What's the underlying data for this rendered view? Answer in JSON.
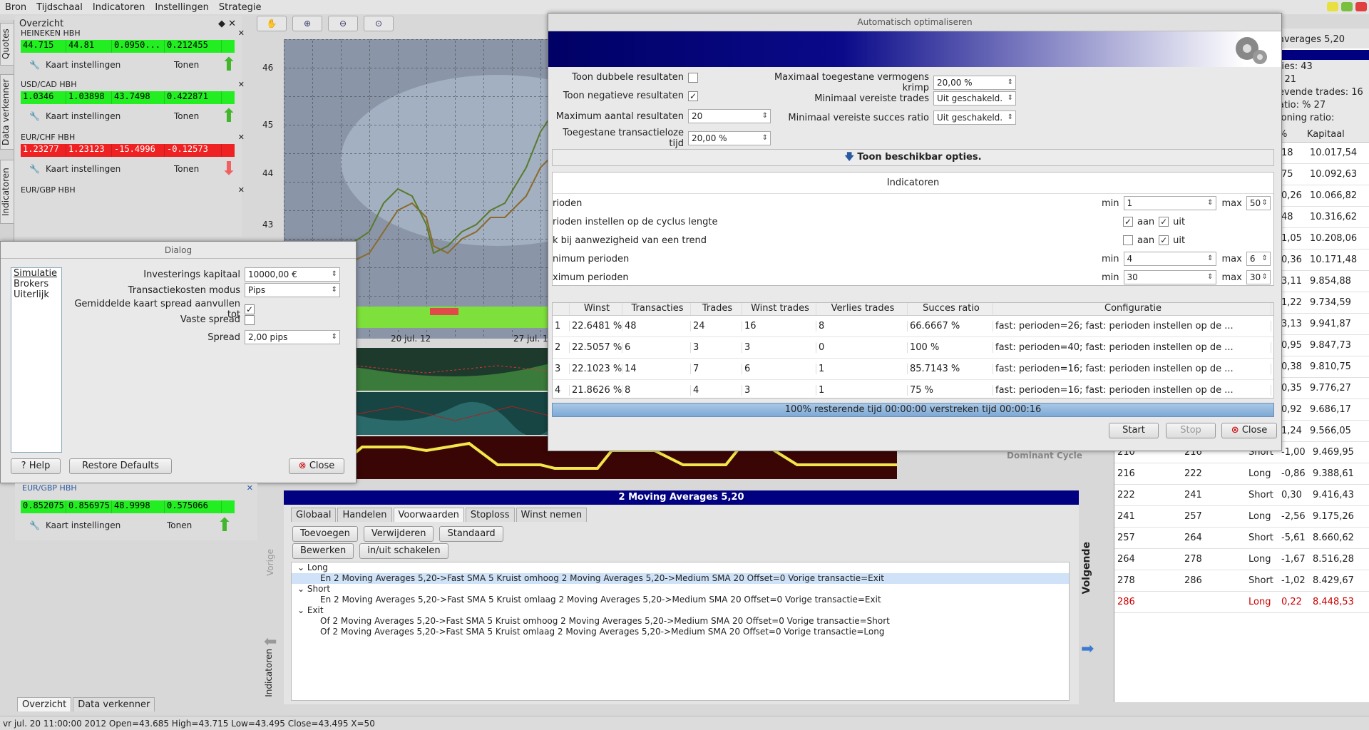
{
  "menubar": {
    "items": [
      "Bron",
      "Tijdschaal",
      "Indicatoren",
      "Instellingen",
      "Strategie"
    ]
  },
  "vtabs": [
    "Quotes",
    "Data verkenner",
    "Indicatoren"
  ],
  "overview": {
    "title": "Overzicht",
    "quotes": [
      {
        "name": "HEINEKEN HBH",
        "values": [
          "44.715",
          "44.81",
          "0.0950...",
          "0.212455"
        ],
        "color": "#22ee22",
        "settings": "Kaart instellingen",
        "show": "Tonen",
        "direction": "up"
      },
      {
        "name": "USD/CAD HBH",
        "values": [
          "1.0346",
          "1.03898",
          "43.7498",
          "0.422871"
        ],
        "color": "#22ee22",
        "settings": "Kaart instellingen",
        "show": "Tonen",
        "direction": "up"
      },
      {
        "name": "EUR/CHF HBH",
        "values": [
          "1.23277",
          "1.23123",
          "-15.4996",
          "-0.12573"
        ],
        "color": "#ee2222",
        "settings": "Kaart instellingen",
        "show": "Tonen",
        "direction": "down"
      },
      {
        "name": "EUR/GBP HBH",
        "values": [],
        "color": "",
        "settings": "",
        "show": "",
        "direction": ""
      }
    ],
    "bottom_quote": {
      "name": "EUR/GBP HBH",
      "values": [
        "0.852075",
        "0.856975",
        "48.9998",
        "0.575066"
      ],
      "settings": "Kaart instellingen",
      "show": "Tonen"
    },
    "bottom_tabs": [
      "Overzicht",
      "Data verkenner"
    ]
  },
  "chart": {
    "yticks": [
      "46",
      "45",
      "44",
      "43"
    ],
    "xticks": [
      "20 jul. 12",
      "27 jul. 1"
    ],
    "indicator_label": "Dominant Cycle"
  },
  "right_table": {
    "title": "averages 5,20",
    "stats": [
      ":ies: 43",
      ": 21",
      "evende trades: 16",
      "atio: % 27",
      "loning ratio:"
    ],
    "header": [
      "%",
      "Kapitaal"
    ],
    "rows_top": [
      {
        "pct": "18",
        "cap": "10.017,54"
      },
      {
        "pct": "75",
        "cap": "10.092,63"
      },
      {
        "pct": "0,26",
        "cap": "10.066,82"
      },
      {
        "pct": "48",
        "cap": "10.316,62"
      },
      {
        "pct": "1,05",
        "cap": "10.208,06"
      },
      {
        "pct": "0,36",
        "cap": "10.171,48"
      },
      {
        "pct": "3,11",
        "cap": "9.854,88"
      },
      {
        "pct": "1,22",
        "cap": "9.734,59"
      },
      {
        "pct": "3,13",
        "cap": "9.941,87"
      },
      {
        "pct": "0,95",
        "cap": "9.847,73"
      },
      {
        "pct": "0,38",
        "cap": "9.810,75"
      },
      {
        "pct": "0,35",
        "cap": "9.776,27"
      },
      {
        "pct": "0,92",
        "cap": "9.686,17"
      },
      {
        "pct": "1,24",
        "cap": "9.566,05"
      }
    ],
    "rows": [
      {
        "a": "210",
        "b": "216",
        "type": "Short",
        "pct": "-1,00",
        "cap": "9.469,95"
      },
      {
        "a": "216",
        "b": "222",
        "type": "Long",
        "pct": "-0,86",
        "cap": "9.388,61"
      },
      {
        "a": "222",
        "b": "241",
        "type": "Short",
        "pct": "0,30",
        "cap": "9.416,43"
      },
      {
        "a": "241",
        "b": "257",
        "type": "Long",
        "pct": "-2,56",
        "cap": "9.175,26"
      },
      {
        "a": "257",
        "b": "264",
        "type": "Short",
        "pct": "-5,61",
        "cap": "8.660,62"
      },
      {
        "a": "264",
        "b": "278",
        "type": "Long",
        "pct": "-1,67",
        "cap": "8.516,28"
      },
      {
        "a": "278",
        "b": "286",
        "type": "Short",
        "pct": "-1,02",
        "cap": "8.429,67"
      },
      {
        "a": "286",
        "b": "",
        "type": "Long",
        "pct": "0,22",
        "cap": "8.448,53"
      }
    ]
  },
  "optimizer": {
    "title": "Automatisch optimaliseren",
    "left_fields": [
      {
        "label": "Toon dubbele resultaten",
        "type": "check",
        "value": ""
      },
      {
        "label": "Toon negatieve resultaten",
        "type": "check",
        "value": "✓"
      },
      {
        "label": "Maximum aantal resultaten",
        "type": "spin",
        "value": "20"
      },
      {
        "label": "Toegestane transactieloze tijd",
        "type": "spin",
        "value": "20,00 %"
      }
    ],
    "right_fields": [
      {
        "label": "Maximaal toegestane vermogens krimp",
        "value": "20,00 %"
      },
      {
        "label": "Minimaal vereiste trades",
        "value": "Uit geschakeld."
      },
      {
        "label": "Minimaal vereiste succes ratio",
        "value": "Uit geschakeld."
      }
    ],
    "toggle_label": "Toon beschikbar opties.",
    "indicators_title": "Indicatoren",
    "indicator_rows": [
      {
        "label": "rioden",
        "kind": "range",
        "min_label": "min",
        "min": "1",
        "max_label": "max",
        "max": "50"
      },
      {
        "label": "rioden instellen op de cyclus lengte",
        "kind": "onoff",
        "on": "aan",
        "off": "uit",
        "on_checked": "✓",
        "off_checked": "✓"
      },
      {
        "label": "k bij aanwezigheid van een trend",
        "kind": "onoff",
        "on": "aan",
        "off": "uit",
        "on_checked": "",
        "off_checked": "✓"
      },
      {
        "label": "nimum perioden",
        "kind": "range",
        "min_label": "min",
        "min": "4",
        "max_label": "max",
        "max": "6"
      },
      {
        "label": "ximum perioden",
        "kind": "range",
        "min_label": "min",
        "min": "30",
        "max_label": "max",
        "max": "30"
      }
    ],
    "results_header": [
      "",
      "Winst",
      "Transacties",
      "Trades",
      "Winst trades",
      "Verlies trades",
      "Succes ratio",
      "Configuratie"
    ],
    "results": [
      [
        "1",
        "22.6481 %",
        "48",
        "24",
        "16",
        "8",
        "66.6667 %",
        "fast: perioden=26; fast: perioden instellen op de ..."
      ],
      [
        "2",
        "22.5057 %",
        "6",
        "3",
        "3",
        "0",
        "100 %",
        "fast: perioden=40; fast: perioden instellen op de ..."
      ],
      [
        "3",
        "22.1023 %",
        "14",
        "7",
        "6",
        "1",
        "85.7143 %",
        "fast: perioden=16; fast: perioden instellen op de ..."
      ],
      [
        "4",
        "21.8626 %",
        "8",
        "4",
        "3",
        "1",
        "75 %",
        "fast: perioden=16; fast: perioden instellen op de ..."
      ]
    ],
    "progress": {
      "text": "100% resterende tijd 00:00:00 verstreken tijd 00:00:16",
      "value": 1.0
    },
    "buttons": {
      "start": "Start",
      "stop": "Stop",
      "close": "Close"
    }
  },
  "dialog": {
    "title": "Dialog",
    "list": [
      "Simulatie",
      "Brokers",
      "Uiterlijk"
    ],
    "fields": [
      {
        "label": "Investerings kapitaal",
        "type": "spin",
        "value": "10000,00 €"
      },
      {
        "label": "Transactiekosten modus",
        "type": "select",
        "value": "Pips"
      },
      {
        "label": "Gemiddelde kaart spread aanvullen tot",
        "type": "check",
        "value": "✓"
      },
      {
        "label": "Vaste spread",
        "type": "check",
        "value": ""
      },
      {
        "label": "Spread",
        "type": "spin",
        "value": "2,00 pips"
      }
    ],
    "buttons": {
      "help": "Help",
      "restore": "Restore Defaults",
      "close": "Close"
    }
  },
  "conditions": {
    "title": "2 Moving Averages 5,20",
    "tabs": [
      "Globaal",
      "Handelen",
      "Voorwaarden",
      "Stoploss",
      "Winst nemen"
    ],
    "active_tab": "Voorwaarden",
    "buttons_row1": [
      "Toevoegen",
      "Verwijderen",
      "Standaard"
    ],
    "buttons_row2": [
      "Bewerken",
      "in/uit schakelen"
    ],
    "side_left": "Vorige",
    "side_right": "Volgende",
    "side_indicators": "Indicatoren",
    "tree": [
      {
        "level": 0,
        "text": "Long"
      },
      {
        "level": 1,
        "text": "En 2 Moving Averages 5,20->Fast SMA 5 Kruist omhoog 2 Moving Averages 5,20->Medium SMA 20 Offset=0 Vorige transactie=Exit",
        "selected": true
      },
      {
        "level": 0,
        "text": "Short"
      },
      {
        "level": 1,
        "text": "En 2 Moving Averages 5,20->Fast SMA 5 Kruist omlaag 2 Moving Averages 5,20->Medium SMA 20 Offset=0 Vorige transactie=Exit"
      },
      {
        "level": 0,
        "text": "Exit"
      },
      {
        "level": 1,
        "text": "Of 2 Moving Averages 5,20->Fast SMA 5 Kruist omhoog 2 Moving Averages 5,20->Medium SMA 20 Offset=0 Vorige transactie=Short"
      },
      {
        "level": 1,
        "text": "Of 2 Moving Averages 5,20->Fast SMA 5 Kruist omlaag 2 Moving Averages 5,20->Medium SMA 20 Offset=0 Vorige transactie=Long"
      }
    ]
  },
  "status": {
    "text": "vr jul. 20 11:00:00 2012 Open=43.685 High=43.715 Low=43.495 Close=43.495 X=50"
  }
}
